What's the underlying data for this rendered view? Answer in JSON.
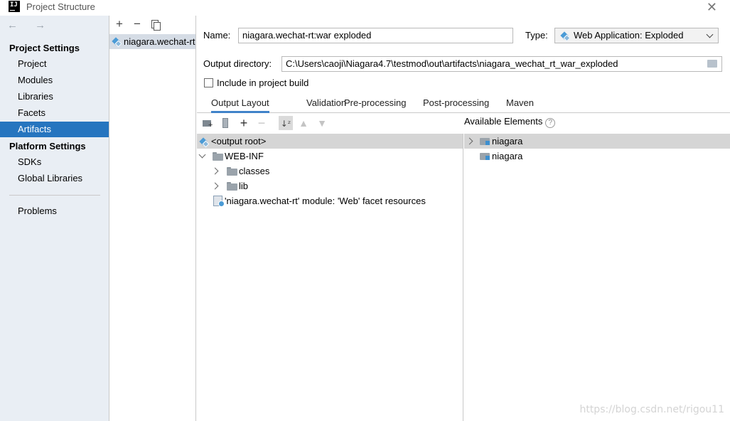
{
  "window": {
    "title": "Project Structure",
    "close_symbol": "✕"
  },
  "nav": {
    "back_forward": "← →",
    "project_settings_header": "Project Settings",
    "project_settings_items": [
      "Project",
      "Modules",
      "Libraries",
      "Facets",
      "Artifacts"
    ],
    "selected_item": "Artifacts",
    "platform_settings_header": "Platform Settings",
    "platform_settings_items": [
      "SDKs",
      "Global Libraries"
    ],
    "problems": "Problems"
  },
  "artifacts_list": {
    "toolbar": [
      "+",
      "−",
      "copy-icon"
    ],
    "items": [
      "niagara.wechat-rt"
    ]
  },
  "form": {
    "name_label": "Name:",
    "name_value": "niagara.wechat-rt:war exploded",
    "type_label": "Type:",
    "type_value": "Web Application: Exploded",
    "output_dir_label": "Output directory:",
    "output_dir_value": "C:\\Users\\caoji\\Niagara4.7\\testmod\\out\\artifacts\\niagara_wechat_rt_war_exploded",
    "include_label": "Include in project build",
    "include_checked": false
  },
  "tabs": [
    "Output Layout",
    "Validation",
    "Pre-processing",
    "Post-processing",
    "Maven"
  ],
  "active_tab": "Output Layout",
  "layout_toolbar": [
    "new-folder-icon",
    "archive-icon",
    "+",
    "−",
    "sort-icon",
    "up-icon",
    "down-icon"
  ],
  "output_tree": {
    "root": "<output root>",
    "web_inf": "WEB-INF",
    "classes": "classes",
    "lib": "lib",
    "facet_resources": "'niagara.wechat-rt' module: 'Web' facet resources"
  },
  "available": {
    "header": "Available Elements",
    "help_symbol": "?",
    "items": [
      "niagara",
      "niagara"
    ]
  },
  "watermark": "https://blog.csdn.net/rigou11"
}
